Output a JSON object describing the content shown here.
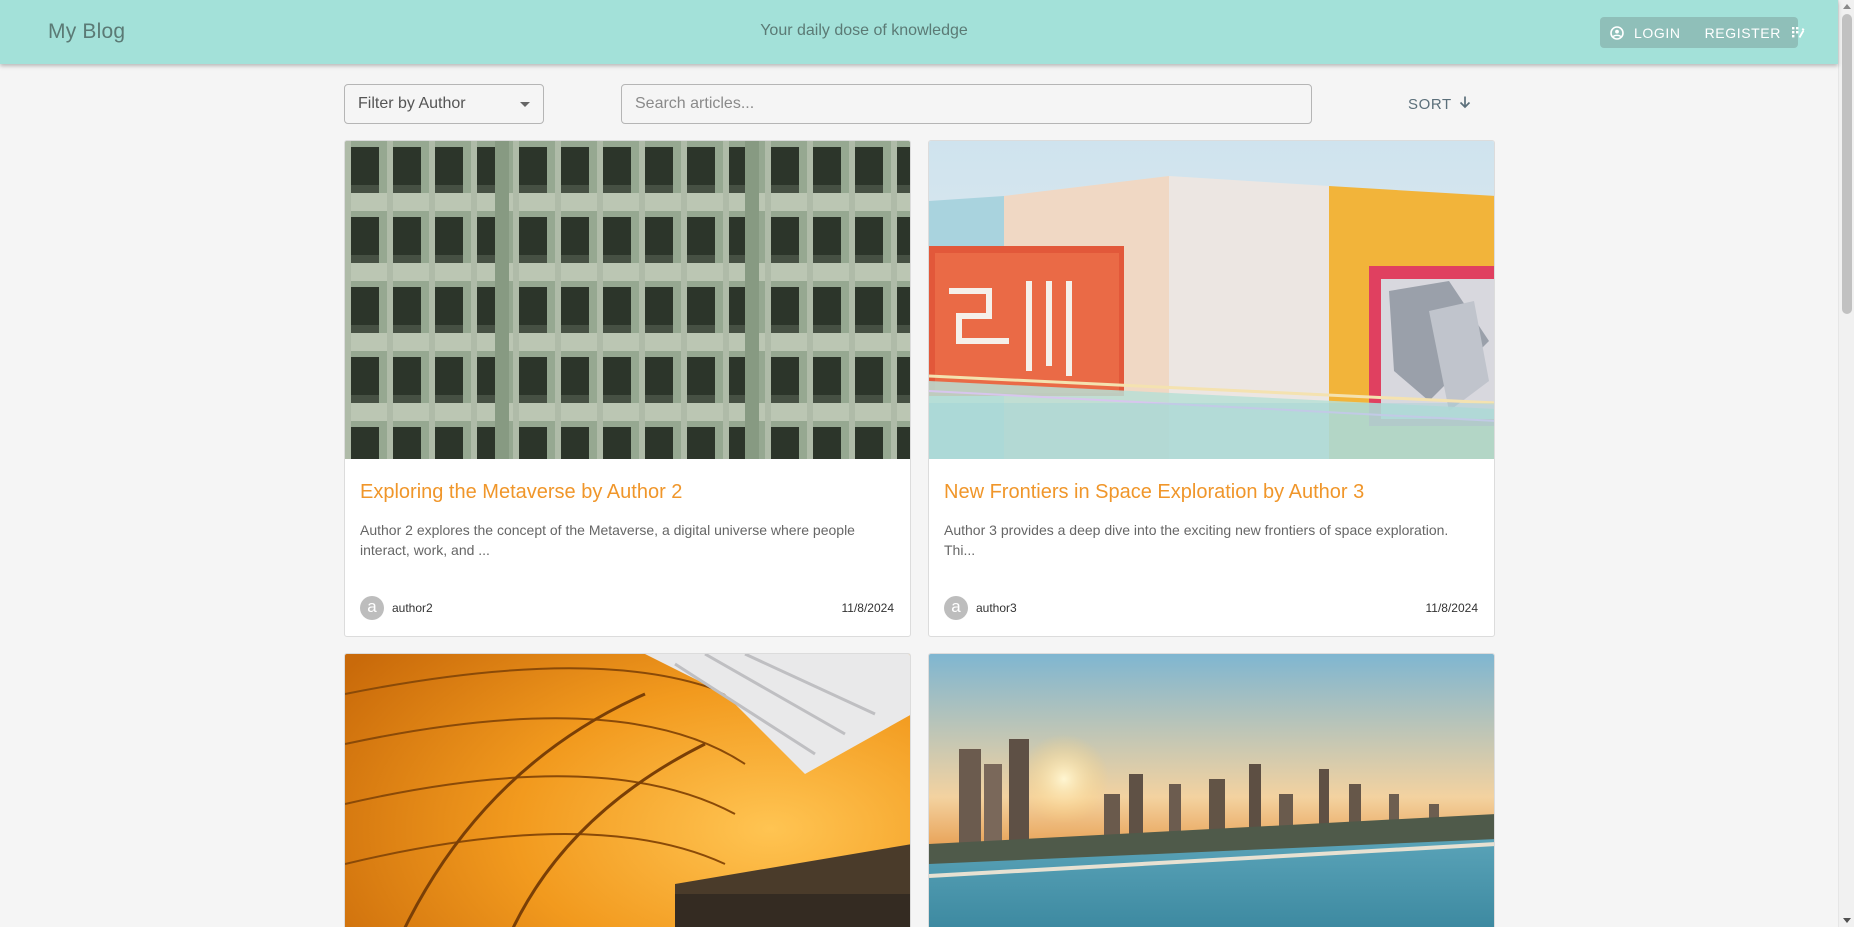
{
  "header": {
    "brand": "My Blog",
    "tagline": "Your daily dose of knowledge",
    "login_label": "LOGIN",
    "register_label": "REGISTER",
    "login_icon": "account-circle-icon",
    "register_icon": "register-grid-icon",
    "background_color": "#a3e1d9"
  },
  "toolbar": {
    "author_filter_label": "Filter by Author",
    "search_placeholder": "Search articles...",
    "search_value": "",
    "sort_label": "SORT",
    "sort_icon": "arrow-down-icon"
  },
  "articles": [
    {
      "title": "Exploring the Metaverse by Author 2",
      "excerpt": "Author 2 explores the concept of the Metaverse, a digital universe where people interact, work, and ...",
      "avatar_letter": "a",
      "author": "author2",
      "date": "11/8/2024",
      "image": "green-building-facade-photo"
    },
    {
      "title": "New Frontiers in Space Exploration by Author 3",
      "excerpt": "Author 3 provides a deep dive into the exciting new frontiers of space exploration. Thi...",
      "avatar_letter": "a",
      "author": "author3",
      "date": "11/8/2024",
      "image": "colorful-building-neon-photo"
    },
    {
      "image": "orange-tunnel-photo"
    },
    {
      "image": "coastal-city-sunset-photo"
    }
  ],
  "colors": {
    "accent_title": "#f0962a",
    "page_background": "#f5f5f5"
  }
}
